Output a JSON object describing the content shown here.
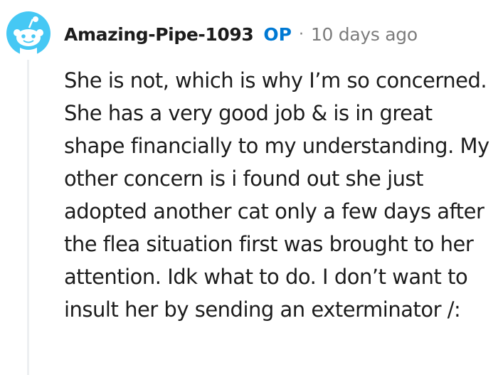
{
  "comment": {
    "author": "Amazing-Pipe-1093",
    "op_badge": "OP",
    "separator": "·",
    "timestamp": "10 days ago",
    "avatar_icon": "snoo-avatar-icon",
    "body": "She is not, which is why I’m so concerned. She has a very good job & is in great shape financially to my understanding. My other concern is i found out she just adopted another cat only a few days after the flea situation first was brought to her attention. Idk what to do. I don’t want to insult her by sending an exterminator /:"
  },
  "colors": {
    "op_badge": "#0079d3",
    "avatar_background": "#46c8f4",
    "metadata_text": "#7c7c7c",
    "body_text": "#1c1c1c",
    "thread_line": "#edeff1"
  }
}
